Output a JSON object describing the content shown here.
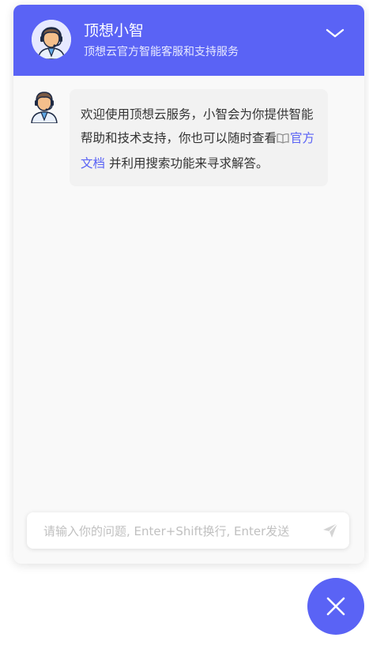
{
  "header": {
    "title": "顶想小智",
    "subtitle": "顶想云官方智能客服和支持服务",
    "avatar_icon": "customer-service-agent-avatar",
    "collapse_icon": "chevron-down-icon"
  },
  "message": {
    "text_before_link": "欢迎使用顶想云服务，小智会为你提供智能帮助和技术支持，你也可以随时查看",
    "link_icon": "book-icon",
    "link_text": "官方文档",
    "text_after_link": " 并利用搜索功能来寻求解答。"
  },
  "input": {
    "placeholder": "请输入你的问题, Enter+Shift换行, Enter发送",
    "value": "",
    "send_icon": "paper-plane-icon"
  },
  "fab": {
    "close_icon": "close-icon"
  },
  "colors": {
    "accent": "#5a63f5",
    "link": "#5a63f5",
    "bubble_bg": "#f2f2f2",
    "window_bg": "#f9f9f9"
  }
}
